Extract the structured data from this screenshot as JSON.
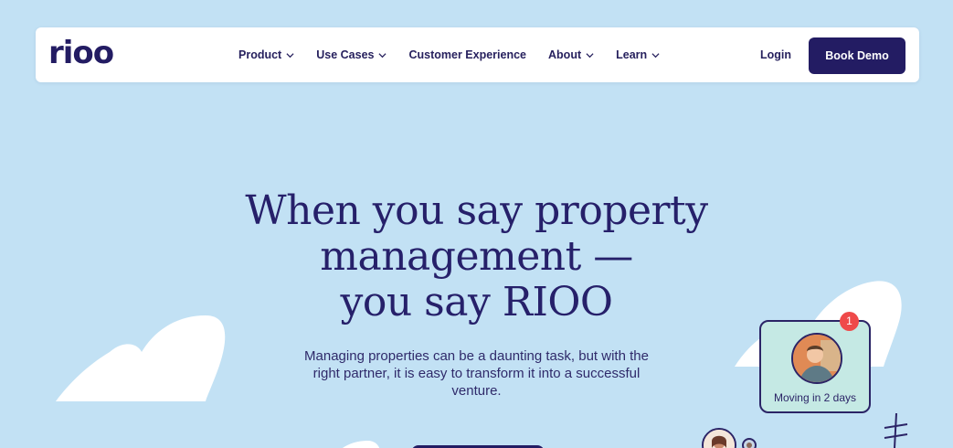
{
  "brand": {
    "logo_text": "rioo"
  },
  "nav": {
    "items": [
      {
        "label": "Product",
        "has_dropdown": true
      },
      {
        "label": "Use Cases",
        "has_dropdown": true
      },
      {
        "label": "Customer Experience",
        "has_dropdown": false
      },
      {
        "label": "About",
        "has_dropdown": true
      },
      {
        "label": "Learn",
        "has_dropdown": true
      }
    ],
    "login_label": "Login",
    "cta_label": "Book Demo"
  },
  "hero": {
    "title_lines": [
      "When you say property",
      "management —",
      "you say RIOO"
    ],
    "subtitle": "Managing properties can be a daunting task, but with the right partner, it is easy to transform it into a successful venture."
  },
  "notification_card": {
    "text": "Moving in 2 days",
    "badge_count": "1"
  },
  "colors": {
    "background": "#c2e1f4",
    "brand_navy": "#231c63",
    "card_bg": "#c5e9e4",
    "badge_red": "#ef4a4a"
  }
}
